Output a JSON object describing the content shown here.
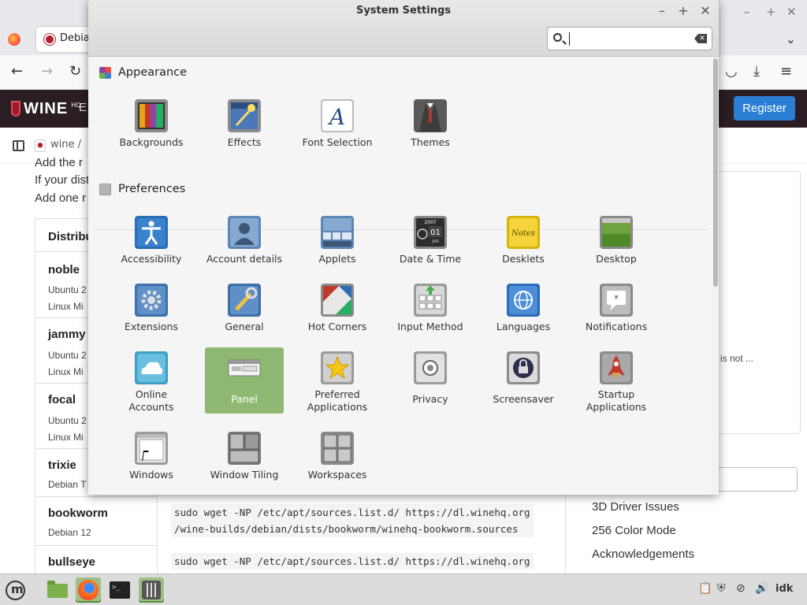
{
  "firefox": {
    "tab_title": "Debia",
    "breadcrumb": "wine  /",
    "wine_nav_first": "E",
    "wine_login_fragment": "n",
    "register_label": "Register",
    "wiki_lines": [
      "Add the r",
      "If your dist",
      "Add one r"
    ],
    "table_header": "Distribu",
    "distributions": [
      {
        "name": "noble",
        "sub1": "Ubuntu 2",
        "sub2": "Linux Mi"
      },
      {
        "name": "jammy",
        "sub1": "Ubuntu 2",
        "sub2": "Linux Mi"
      },
      {
        "name": "focal",
        "sub1": "Ubuntu 2",
        "sub2": "Linux Mi"
      },
      {
        "name": "trixie",
        "sub1": "Debian T",
        "sub2": ""
      },
      {
        "name": "bookworm",
        "sub1": "Debian 12",
        "sub2": ""
      },
      {
        "name": "bullseye",
        "sub1": "",
        "sub2": ""
      }
    ],
    "code_bookworm": "sudo wget -NP /etc/apt/sources.list.d/ https://dl.winehq.org\n/wine-builds/debian/dists/bookworm/winehq-bookworm.sources",
    "code_bullseye": "sudo wget -NP /etc/apt/sources.list.d/ https://dl.winehq.org",
    "right_fragment": "is not ...",
    "right_links": [
      "3D Driver Issues",
      "256 Color Mode",
      "Acknowledgements"
    ]
  },
  "settings": {
    "title": "System Settings",
    "search_value": "",
    "sections": [
      {
        "name": "Appearance",
        "items": [
          {
            "label": "Backgrounds",
            "icon": "backgrounds-icon"
          },
          {
            "label": "Effects",
            "icon": "effects-icon"
          },
          {
            "label": "Font Selection",
            "icon": "font-selection-icon"
          },
          {
            "label": "Themes",
            "icon": "themes-icon"
          }
        ]
      },
      {
        "name": "Preferences",
        "items": [
          {
            "label": "Accessibility",
            "icon": "accessibility-icon"
          },
          {
            "label": "Account details",
            "icon": "account-details-icon"
          },
          {
            "label": "Applets",
            "icon": "applets-icon"
          },
          {
            "label": "Date & Time",
            "icon": "date-time-icon"
          },
          {
            "label": "Desklets",
            "icon": "desklets-icon"
          },
          {
            "label": "Desktop",
            "icon": "desktop-icon"
          },
          {
            "label": "Extensions",
            "icon": "extensions-icon"
          },
          {
            "label": "General",
            "icon": "general-icon"
          },
          {
            "label": "Hot Corners",
            "icon": "hot-corners-icon"
          },
          {
            "label": "Input Method",
            "icon": "input-method-icon"
          },
          {
            "label": "Languages",
            "icon": "languages-icon"
          },
          {
            "label": "Notifications",
            "icon": "notifications-icon"
          },
          {
            "label": "Online\nAccounts",
            "icon": "online-accounts-icon"
          },
          {
            "label": "Panel",
            "icon": "panel-icon",
            "selected": true
          },
          {
            "label": "Preferred\nApplications",
            "icon": "preferred-applications-icon"
          },
          {
            "label": "Privacy",
            "icon": "privacy-icon"
          },
          {
            "label": "Screensaver",
            "icon": "screensaver-icon"
          },
          {
            "label": "Startup\nApplications",
            "icon": "startup-applications-icon"
          },
          {
            "label": "Windows",
            "icon": "windows-icon"
          },
          {
            "label": "Window Tiling",
            "icon": "window-tiling-icon"
          },
          {
            "label": "Workspaces",
            "icon": "workspaces-icon"
          }
        ]
      }
    ],
    "date_icon_text": {
      "year": "2007",
      "day": "01",
      "month": "JAN"
    }
  },
  "taskbar": {
    "user_label": "idk"
  },
  "colors": {
    "selected_tile": "#8fb872",
    "wine_header": "#2b1d24",
    "register_button": "#2a7fd4"
  }
}
